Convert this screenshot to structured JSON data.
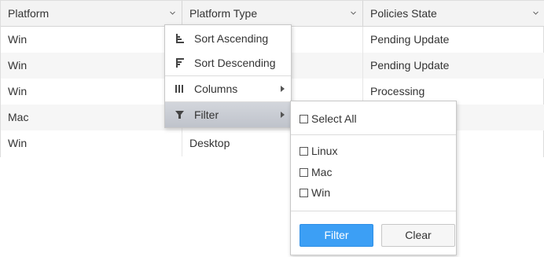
{
  "header": {
    "columns": [
      {
        "label": "Platform"
      },
      {
        "label": "Platform Type"
      },
      {
        "label": "Policies State"
      }
    ]
  },
  "rows": [
    {
      "platform": "Win",
      "platform_type": "",
      "policies_state": "Pending Update"
    },
    {
      "platform": "Win",
      "platform_type": "",
      "policies_state": "Pending Update"
    },
    {
      "platform": "Win",
      "platform_type": "",
      "policies_state": "Processing"
    },
    {
      "platform": "Mac",
      "platform_type": "",
      "policies_state": ""
    },
    {
      "platform": "Win",
      "platform_type": "Desktop",
      "policies_state": ""
    }
  ],
  "column_menu": {
    "items": [
      {
        "label": "Sort Ascending",
        "icon": "sort-ascending-icon"
      },
      {
        "label": "Sort Descending",
        "icon": "sort-descending-icon"
      },
      {
        "label": "Columns",
        "icon": "columns-icon"
      },
      {
        "label": "Filter",
        "icon": "filter-icon"
      }
    ]
  },
  "filter_panel": {
    "select_all": "Select All",
    "options": [
      "Linux",
      "Mac",
      "Win"
    ],
    "filter_button": "Filter",
    "clear_button": "Clear"
  },
  "colors": {
    "accent": "#3c9ff5",
    "header_bg": "#f3f3f3",
    "active_menu_bg": "#c9ccd3"
  }
}
